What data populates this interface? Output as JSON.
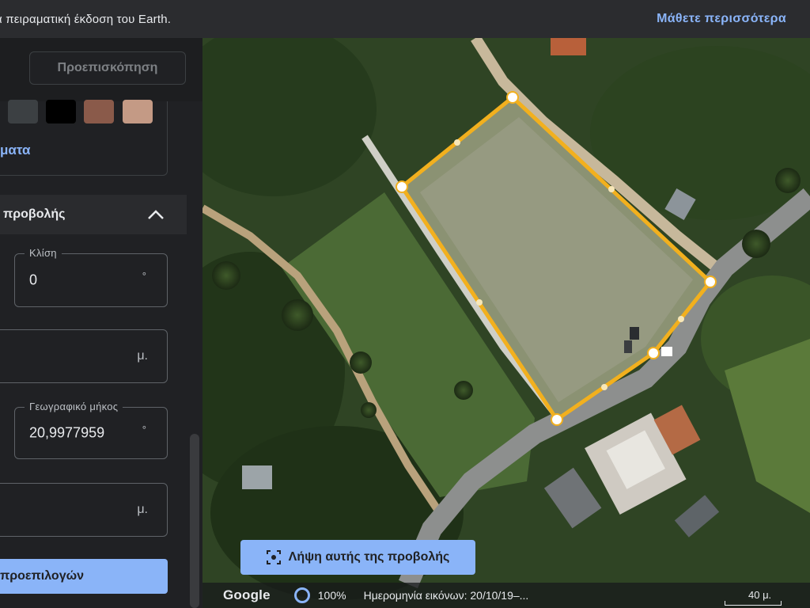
{
  "banner": {
    "text": "α πειραματική έκδοση του Earth.",
    "link": "Μάθετε περισσότερα"
  },
  "panel": {
    "preview_label": "Προεπισκόπηση",
    "colors_link": "ματα",
    "swatches": [
      "#3c4043",
      "#000000",
      "#8a5a4a",
      "#c49a85"
    ],
    "section_title": "προβολής",
    "fields": {
      "tilt_label": "Κλίση",
      "tilt_value": "0",
      "tilt_unit": "°",
      "altitude_unit": "μ.",
      "longitude_label": "Γεωγραφικό μήκος",
      "longitude_value": "20,9977959",
      "longitude_unit": "°",
      "range_unit": "μ."
    },
    "bottom_button": "προεπιλογών"
  },
  "map": {
    "capture_button": "Λήψη αυτής της προβολής",
    "attribution": "Google",
    "zoom": "100%",
    "imagery_date": "Ημερομηνία εικόνων: 20/10/19–...",
    "scale": "40 μ.",
    "polygon_color": "#f2b01e"
  }
}
